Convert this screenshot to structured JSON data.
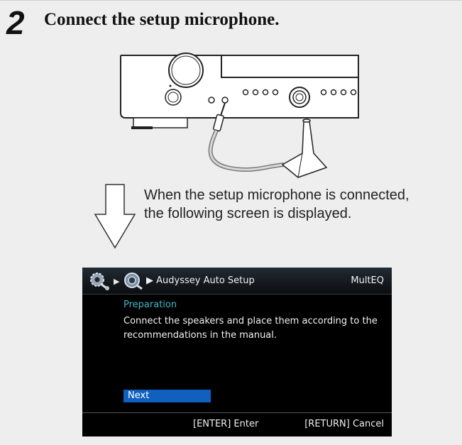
{
  "step": {
    "number": "2",
    "title": "Connect the setup microphone."
  },
  "description": "When the setup microphone is connected, the following screen is displayed.",
  "osd": {
    "breadcrumb": "Audyssey Auto Setup",
    "brand": "MultEQ",
    "section": "Preparation",
    "message": "Connect the speakers and place them according to the recommendations in the manual.",
    "next_label": "Next",
    "footer_enter": "[ENTER] Enter",
    "footer_cancel": "[RETURN] Cancel",
    "icons": [
      "setup-gear-icon",
      "audyssey-speaker-icon"
    ],
    "colors": {
      "section": "#3fb8c8",
      "selection": "#1060c0",
      "background": "#000000"
    }
  }
}
